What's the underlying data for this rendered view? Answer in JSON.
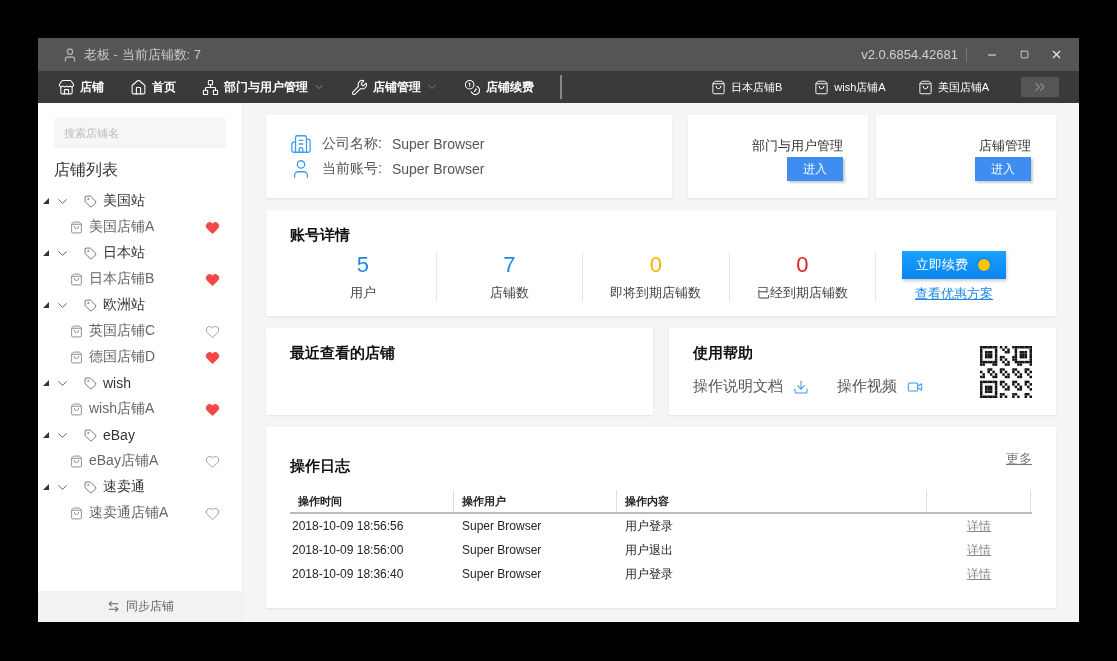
{
  "window": {
    "title": "老板 - 当前店铺数: 7",
    "version": "v2.0.6854.42681"
  },
  "nav": {
    "items": [
      {
        "label": "店铺",
        "has_menu": false
      },
      {
        "label": "首页",
        "has_menu": false
      },
      {
        "label": "部门与用户管理",
        "has_menu": true
      },
      {
        "label": "店铺管理",
        "has_menu": true
      },
      {
        "label": "店铺续费",
        "has_menu": false
      }
    ],
    "open_stores": [
      "日本店铺B",
      "wish店铺A",
      "美国店铺A"
    ]
  },
  "sidebar": {
    "search": {
      "placeholder": "搜索店铺名"
    },
    "title": "店铺列表",
    "groups": [
      {
        "label": "美国站",
        "expanded": true,
        "children": [
          {
            "label": "美国店铺A",
            "favorite": true
          }
        ]
      },
      {
        "label": "日本站",
        "expanded": true,
        "children": [
          {
            "label": "日本店铺B",
            "favorite": true
          }
        ]
      },
      {
        "label": "欧洲站",
        "expanded": true,
        "children": [
          {
            "label": "英国店铺C",
            "favorite": false
          },
          {
            "label": "德国店铺D",
            "favorite": true
          }
        ]
      },
      {
        "label": "wish",
        "expanded": true,
        "children": [
          {
            "label": "wish店铺A",
            "favorite": true
          }
        ]
      },
      {
        "label": "eBay",
        "expanded": true,
        "children": [
          {
            "label": "eBay店铺A",
            "favorite": false
          }
        ]
      },
      {
        "label": "速卖通",
        "expanded": true,
        "children": [
          {
            "label": "速卖通店铺A",
            "favorite": false
          }
        ]
      }
    ],
    "footer": "同步店铺"
  },
  "company": {
    "fields": [
      {
        "label": "公司名称:",
        "value": "Super Browser"
      },
      {
        "label": "当前账号:",
        "value": "Super Browser"
      }
    ]
  },
  "shortcuts": [
    {
      "title": "部门与用户管理",
      "button": "进入"
    },
    {
      "title": "店铺管理",
      "button": "进入"
    }
  ],
  "account": {
    "title": "账号详情",
    "stats": [
      {
        "value": "5",
        "label": "用户",
        "color": "#1e88e5"
      },
      {
        "value": "7",
        "label": "店铺数",
        "color": "#1e88e5"
      },
      {
        "value": "0",
        "label": "即将到期店铺数",
        "color": "#f5b400"
      },
      {
        "value": "0",
        "label": "已经到期店铺数",
        "color": "#e02020"
      }
    ],
    "renew_button": "立即续费",
    "offer_link": "查看优惠方案"
  },
  "recent": {
    "title": "最近查看的店铺"
  },
  "help": {
    "title": "使用帮助",
    "links": [
      "操作说明文档",
      "操作视频"
    ]
  },
  "log": {
    "title": "操作日志",
    "more": "更多",
    "columns": [
      "操作时间",
      "操作用户",
      "操作内容"
    ],
    "rows": [
      {
        "time": "2018-10-09 18:56:56",
        "user": "Super Browser",
        "content": "用户登录",
        "action": "详情"
      },
      {
        "time": "2018-10-09 18:56:00",
        "user": "Super Browser",
        "content": "用户退出",
        "action": "详情"
      },
      {
        "time": "2018-10-09 18:36:40",
        "user": "Super Browser",
        "content": "用户登录",
        "action": "详情"
      }
    ]
  }
}
